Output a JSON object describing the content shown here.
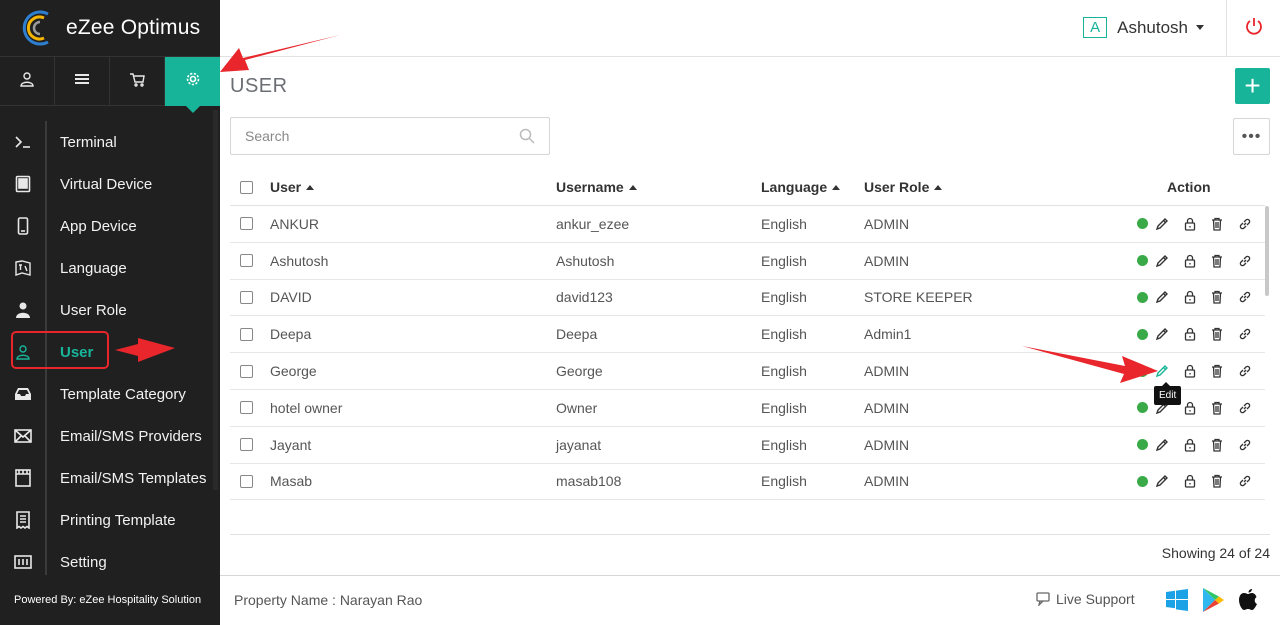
{
  "app": {
    "name": "eZee Optimus",
    "powered_by": "Powered By: eZee Hospitality Solution"
  },
  "header": {
    "avatar_letter": "A",
    "user_name": "Ashutosh"
  },
  "top_icons": [
    "user-icon",
    "list-icon",
    "cart-icon",
    "settings-icon"
  ],
  "sidebar": {
    "items": [
      {
        "label": "Terminal",
        "icon": "terminal-icon"
      },
      {
        "label": "Virtual Device",
        "icon": "tablet-icon"
      },
      {
        "label": "App Device",
        "icon": "mobile-icon"
      },
      {
        "label": "Language",
        "icon": "language-icon"
      },
      {
        "label": "User Role",
        "icon": "user-role-icon"
      },
      {
        "label": "User",
        "icon": "user-icon",
        "active": true
      },
      {
        "label": "Template Category",
        "icon": "inbox-icon"
      },
      {
        "label": "Email/SMS Providers",
        "icon": "envelope-icon"
      },
      {
        "label": "Email/SMS Templates",
        "icon": "film-icon"
      },
      {
        "label": "Printing Template",
        "icon": "receipt-icon"
      },
      {
        "label": "Setting",
        "icon": "setting-icon"
      }
    ]
  },
  "page": {
    "title": "USER",
    "add_label": "+",
    "more_label": "•••"
  },
  "search": {
    "placeholder": "Search"
  },
  "table": {
    "columns": [
      "User",
      "Username",
      "Language",
      "User Role",
      "Action"
    ],
    "rows": [
      {
        "user": "ANKUR",
        "username": "ankur_ezee",
        "language": "English",
        "role": "ADMIN"
      },
      {
        "user": "Ashutosh",
        "username": "Ashutosh",
        "language": "English",
        "role": "ADMIN"
      },
      {
        "user": "DAVID",
        "username": "david123",
        "language": "English",
        "role": "STORE KEEPER"
      },
      {
        "user": "Deepa",
        "username": "Deepa",
        "language": "English",
        "role": "Admin1"
      },
      {
        "user": "George",
        "username": "George",
        "language": "English",
        "role": "ADMIN"
      },
      {
        "user": "hotel owner",
        "username": "Owner",
        "language": "English",
        "role": "ADMIN"
      },
      {
        "user": "Jayant",
        "username": "jayanat",
        "language": "English",
        "role": "ADMIN"
      },
      {
        "user": "Masab",
        "username": "masab108",
        "language": "English",
        "role": "ADMIN"
      }
    ],
    "tooltip": "Edit",
    "showing": "Showing 24 of 24"
  },
  "footer": {
    "property": "Property Name : Narayan Rao",
    "support": "Live Support"
  },
  "colors": {
    "accent": "#18b49a",
    "sidebar": "#202020",
    "status_active": "#3aaa48",
    "annotation": "#e8262b"
  }
}
